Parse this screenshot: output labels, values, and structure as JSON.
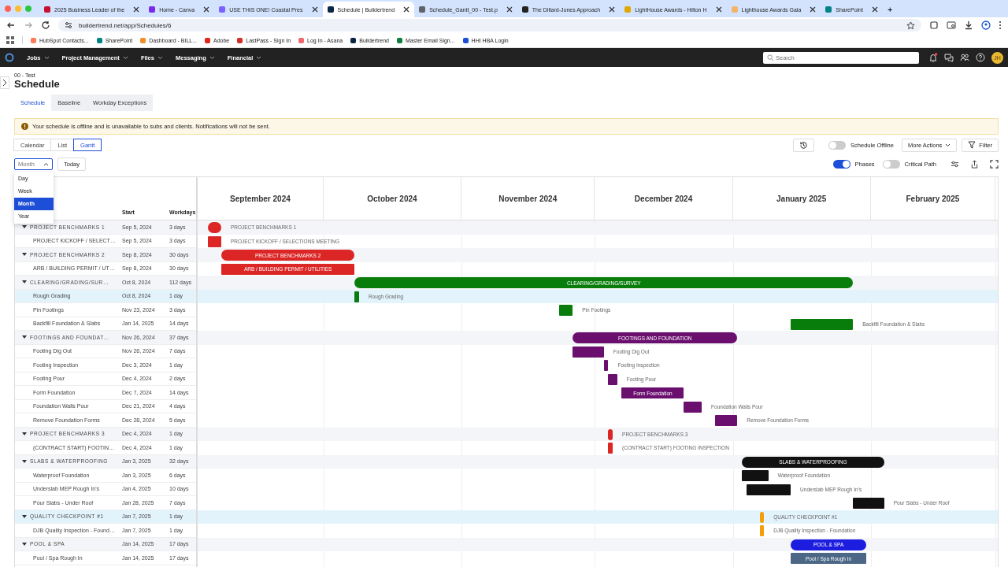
{
  "browser": {
    "tabs": [
      {
        "title": "2025 Business Leader of the",
        "selected": false,
        "color": "#c8102e"
      },
      {
        "title": "Home - Canva",
        "selected": false,
        "color": "#7d2ae8"
      },
      {
        "title": "USE THIS ONE! Coastal Pres",
        "selected": false,
        "color": "#7b61ff"
      },
      {
        "title": "Schedule | Buildertrend",
        "selected": true,
        "color": "#0b2545"
      },
      {
        "title": "Schedule_Gantt_00 - Test.p",
        "selected": false,
        "color": "#5f6368"
      },
      {
        "title": "The Dillard-Jones Approach",
        "selected": false,
        "color": "#222222"
      },
      {
        "title": "LightHouse Awards - Hilton H",
        "selected": false,
        "color": "#e0a800"
      },
      {
        "title": "Lighthouse Awards Gala",
        "selected": false,
        "color": "#f2b36b"
      },
      {
        "title": "SharePoint",
        "selected": false,
        "color": "#038387"
      }
    ],
    "new_tab": "+",
    "url": "buildertrend.net/app/Schedules/6",
    "bookmarks": [
      {
        "label": "HubSpot Contacts...",
        "color": "#ff7a59"
      },
      {
        "label": "SharePoint",
        "color": "#038387"
      },
      {
        "label": "Dashboard - BILL...",
        "color": "#f28c28"
      },
      {
        "label": "Adobe",
        "color": "#e1251b"
      },
      {
        "label": "LastPass - Sign In",
        "color": "#d32d27"
      },
      {
        "label": "Log In - Asana",
        "color": "#f06a6a"
      },
      {
        "label": "Buildertrend",
        "color": "#0b2545"
      },
      {
        "label": "Master Email Sign...",
        "color": "#107c41"
      },
      {
        "label": "HHI HBA Login",
        "color": "#1d4ed8"
      }
    ]
  },
  "nav": {
    "menus": [
      "Jobs",
      "Project Management",
      "Files",
      "Messaging",
      "Financial"
    ],
    "search": {
      "placeholder": "Search"
    },
    "notification": true,
    "avatar": "JH"
  },
  "page": {
    "breadcrumb": "00 - Test",
    "title": "Schedule",
    "tabs": [
      {
        "label": "Schedule",
        "selected": true
      },
      {
        "label": "Baseline",
        "selected": false
      },
      {
        "label": "Workday Exceptions",
        "selected": false
      }
    ],
    "alert": "Your schedule is offline and is unavailable to subs and clients. Notifications will not be sent.",
    "views": [
      {
        "label": "Calendar",
        "selected": false
      },
      {
        "label": "List",
        "selected": false
      },
      {
        "label": "Gantt",
        "selected": true
      }
    ],
    "scale_field": {
      "placeholder": "Month"
    },
    "scale_options": [
      {
        "label": "Day",
        "selected": false
      },
      {
        "label": "Week",
        "selected": false
      },
      {
        "label": "Month",
        "selected": true
      },
      {
        "label": "Year",
        "selected": false
      }
    ],
    "today": "Today",
    "offline_toggle": {
      "label": "Schedule Offline",
      "on": false
    },
    "more_actions": "More Actions",
    "filter": "Filter",
    "phases_toggle": {
      "label": "Phases",
      "on": true
    },
    "critical_toggle": {
      "label": "Critical Path",
      "on": false
    }
  },
  "gantt": {
    "columns": [
      "Start",
      "Workdays"
    ],
    "months": [
      "September 2024",
      "October 2024",
      "November 2024",
      "December 2024",
      "January 2025",
      "February 2025"
    ],
    "rows": [
      {
        "kind": "phase",
        "name": "PROJECT BENCHMARKS 1",
        "bar_label": "PROJECT BENCHMARKS 1",
        "start": "Sep 5, 2024",
        "workdays": "3 days",
        "color": "#dc2626",
        "label_inside": false,
        "selected": false
      },
      {
        "kind": "task",
        "name": "PROJECT KICKOFF / SELECT…",
        "bar_label": "PROJECT KICKOFF / SELECTIONS MEETING",
        "start": "Sep 5, 2024",
        "workdays": "3 days",
        "color": "#dc2626",
        "label_inside": false,
        "selected": false
      },
      {
        "kind": "phase",
        "name": "PROJECT BENCHMARKS 2",
        "bar_label": "PROJECT BENCHMARKS 2",
        "start": "Sep 8, 2024",
        "workdays": "30 days",
        "color": "#dc2626",
        "label_inside": true,
        "selected": false
      },
      {
        "kind": "task",
        "name": "ARB / BUILDING PERMIT / UT…",
        "bar_label": "ARB / BUILDING PERMIT / UTILITIES",
        "start": "Sep 8, 2024",
        "workdays": "30 days",
        "color": "#dc2626",
        "label_inside": true,
        "selected": false
      },
      {
        "kind": "phase",
        "name": "CLEARING/GRADING/SUR…",
        "bar_label": "CLEARING/GRADING/SURVEY",
        "start": "Oct 8, 2024",
        "workdays": "112 days",
        "color": "#087d0c",
        "label_inside": true,
        "selected": false
      },
      {
        "kind": "task",
        "name": "Rough Grading",
        "bar_label": "Rough Grading",
        "start": "Oct 8, 2024",
        "workdays": "1 day",
        "color": "#087d0c",
        "label_inside": false,
        "selected": true
      },
      {
        "kind": "task",
        "name": "Pin Footings",
        "bar_label": "Pin Footings",
        "start": "Nov 23, 2024",
        "workdays": "3 days",
        "color": "#087d0c",
        "label_inside": false,
        "selected": false
      },
      {
        "kind": "task",
        "name": "Backfill Foundation & Slabs",
        "bar_label": "Backfill Foundation & Slabs",
        "start": "Jan 14, 2025",
        "workdays": "14 days",
        "color": "#087d0c",
        "label_inside": false,
        "selected": false
      },
      {
        "kind": "phase",
        "name": "FOOTINGS AND FOUNDAT…",
        "bar_label": "FOOTINGS AND FOUNDATION",
        "start": "Nov 26, 2024",
        "workdays": "37 days",
        "color": "#6b0f6f",
        "label_inside": true,
        "selected": false
      },
      {
        "kind": "task",
        "name": "Footing Dig Out",
        "bar_label": "Footing Dig Out",
        "start": "Nov 26, 2024",
        "workdays": "7 days",
        "color": "#6b0f6f",
        "label_inside": false,
        "selected": false
      },
      {
        "kind": "task",
        "name": "Footing Inspection",
        "bar_label": "Footing Inspection",
        "start": "Dec 3, 2024",
        "workdays": "1 day",
        "color": "#6b0f6f",
        "label_inside": false,
        "selected": false
      },
      {
        "kind": "task",
        "name": "Footing Pour",
        "bar_label": "Footing Pour",
        "start": "Dec 4, 2024",
        "workdays": "2 days",
        "color": "#6b0f6f",
        "label_inside": false,
        "selected": false
      },
      {
        "kind": "task",
        "name": "Form Foundation",
        "bar_label": "Form Foundation",
        "start": "Dec 7, 2024",
        "workdays": "14 days",
        "color": "#6b0f6f",
        "label_inside": true,
        "selected": false
      },
      {
        "kind": "task",
        "name": "Foundation Walls Pour",
        "bar_label": "Foundation Walls Pour",
        "start": "Dec 21, 2024",
        "workdays": "4 days",
        "color": "#6b0f6f",
        "label_inside": false,
        "selected": false
      },
      {
        "kind": "task",
        "name": "Remove Foundation Forms",
        "bar_label": "Remove Foundation Forms",
        "start": "Dec 28, 2024",
        "workdays": "5 days",
        "color": "#6b0f6f",
        "label_inside": false,
        "selected": false
      },
      {
        "kind": "phase",
        "name": "PROJECT BENCHMARKS 3",
        "bar_label": "PROJECT BENCHMARKS 3",
        "start": "Dec 4, 2024",
        "workdays": "1 day",
        "color": "#dc2626",
        "label_inside": false,
        "selected": false
      },
      {
        "kind": "task",
        "name": "(CONTRACT START) FOOTIN…",
        "bar_label": "(CONTRACT START) FOOTING INSPECTION",
        "start": "Dec 4, 2024",
        "workdays": "1 day",
        "color": "#dc2626",
        "label_inside": false,
        "selected": false
      },
      {
        "kind": "phase",
        "name": "SLABS & WATERPROOFING",
        "bar_label": "SLABS & WATERPROOFING",
        "start": "Jan 3, 2025",
        "workdays": "32 days",
        "color": "#111111",
        "label_inside": true,
        "selected": false
      },
      {
        "kind": "task",
        "name": "Waterproof Foundation",
        "bar_label": "Waterproof Foundation",
        "start": "Jan 3, 2025",
        "workdays": "6 days",
        "color": "#111111",
        "label_inside": false,
        "selected": false
      },
      {
        "kind": "task",
        "name": "Underslab MEP Rough In's",
        "bar_label": "Underslab MEP Rough In's",
        "start": "Jan 4, 2025",
        "workdays": "10 days",
        "color": "#111111",
        "label_inside": false,
        "selected": false
      },
      {
        "kind": "task",
        "name": "Pour Slabs - Under Roof",
        "bar_label": "Pour Slabs - Under Roof",
        "start": "Jan 28, 2025",
        "workdays": "7 days",
        "color": "#111111",
        "label_inside": false,
        "selected": false
      },
      {
        "kind": "phase",
        "name": "QUALITY CHECKPOINT #1",
        "bar_label": "QUALITY CHECKPOINT #1",
        "start": "Jan 7, 2025",
        "workdays": "1 day",
        "color": "#f59e0b",
        "label_inside": false,
        "selected": true
      },
      {
        "kind": "task",
        "name": "DJB Quality Inspection - Found…",
        "bar_label": "DJB Quality Inspection - Foundation",
        "start": "Jan 7, 2025",
        "workdays": "1 day",
        "color": "#f59e0b",
        "label_inside": false,
        "selected": false
      },
      {
        "kind": "phase",
        "name": "POOL & SPA",
        "bar_label": "POOL & SPA",
        "start": "Jan 14, 2025",
        "workdays": "17 days",
        "color": "#1d1de0",
        "label_inside": true,
        "selected": false
      },
      {
        "kind": "task",
        "name": "Pool / Spa Rough In",
        "bar_label": "Pool / Spa Rough In",
        "start": "Jan 14, 2025",
        "workdays": "17 days",
        "color": "#4b6785",
        "label_inside": true,
        "selected": false
      }
    ]
  }
}
